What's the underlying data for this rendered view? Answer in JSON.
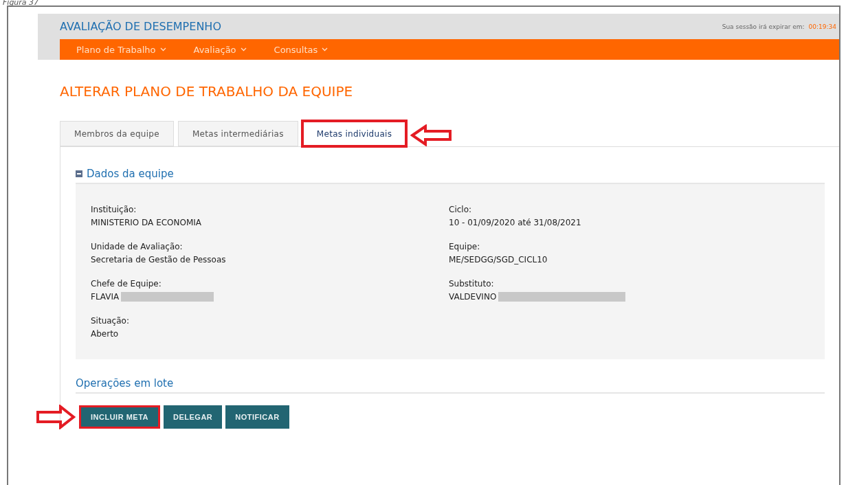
{
  "caption": "Figura 37",
  "header": {
    "title": "AVALIAÇÃO DE DESEMPENHO",
    "session_label": "Sua sessão irá expirar em:",
    "session_time": "00:19:34"
  },
  "nav": [
    {
      "label": "Plano de Trabalho"
    },
    {
      "label": "Avaliação"
    },
    {
      "label": "Consultas"
    }
  ],
  "page_title": "ALTERAR PLANO DE TRABALHO DA EQUIPE",
  "tabs": [
    {
      "label": "Membros da equipe",
      "selected": false,
      "highlighted": false
    },
    {
      "label": "Metas intermediárias",
      "selected": false,
      "highlighted": false
    },
    {
      "label": "Metas individuais",
      "selected": true,
      "highlighted": true
    }
  ],
  "section": {
    "title": "Dados da equipe",
    "expanded": true
  },
  "fields": [
    {
      "label": "Instituição:",
      "value": "MINISTERIO DA ECONOMIA",
      "redacted": false
    },
    {
      "label": "Ciclo:",
      "value": "10 - 01/09/2020 até 31/08/2021",
      "redacted": false
    },
    {
      "label": "Unidade de Avaliação:",
      "value": "Secretaria de Gestão de Pessoas",
      "redacted": false
    },
    {
      "label": "Equipe:",
      "value": "ME/SEDGG/SGD_CICL10",
      "redacted": false
    },
    {
      "label": "Chefe de Equipe:",
      "value": "FLAVIA",
      "redacted": true
    },
    {
      "label": "Substituto:",
      "value": "VALDEVINO",
      "redacted": true
    },
    {
      "label": "Situação:",
      "value": "Aberto",
      "redacted": false
    }
  ],
  "batch": {
    "title": "Operações em lote",
    "buttons": [
      {
        "label": "INCLUIR META",
        "highlighted": true
      },
      {
        "label": "DELEGAR",
        "highlighted": false
      },
      {
        "label": "NOTIFICAR",
        "highlighted": false
      }
    ]
  }
}
